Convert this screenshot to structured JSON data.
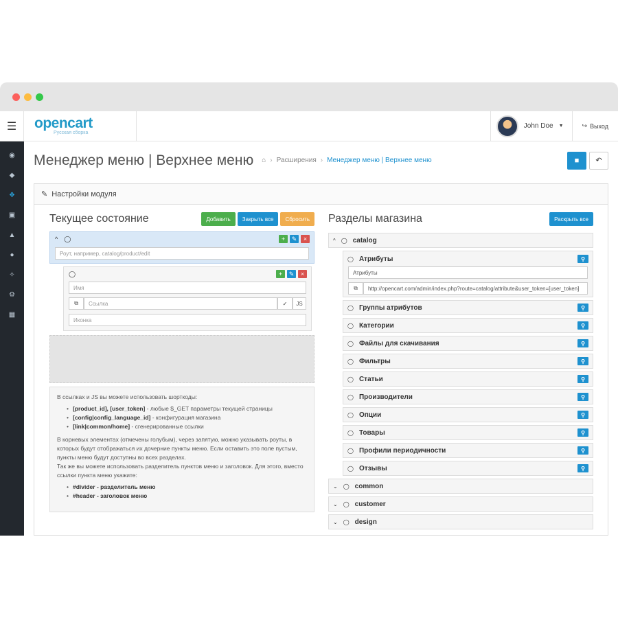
{
  "colors": {
    "accent": "#1e91cf",
    "green": "#4cae4c",
    "orange": "#f0ad4e",
    "red": "#d9534f",
    "sidebar": "#23282e"
  },
  "header": {
    "logo": "opencart",
    "logo_sub": "Русская сборка",
    "user_name": "John Doe",
    "logout": "Выход"
  },
  "sidebar": {
    "icons": [
      "dashboard-icon",
      "tags-icon",
      "puzzle-icon",
      "desktop-icon",
      "cart-icon",
      "user-icon",
      "share-icon",
      "cog-icon",
      "bar-chart-icon"
    ]
  },
  "page": {
    "title": "Менеджер меню | Верхнее меню",
    "breadcrumb_1": "Расширения",
    "breadcrumb_2": "Менеджер меню | Верхнее меню"
  },
  "panel": {
    "title": "Настройки модуля"
  },
  "left": {
    "title": "Текущее состояние",
    "btn_add": "Добавить",
    "btn_close_all": "Закрыть все",
    "btn_reset": "Сбросить",
    "route_placeholder": "Роут, например, catalog/product/edit",
    "name_placeholder": "Имя",
    "link_placeholder": "Ссылка",
    "js_label": "JS",
    "icon_placeholder": "Иконка",
    "help": {
      "intro": "В ссылках и JS вы можете использовать шорткоды:",
      "sc1_code": "[product_id], [user_token]",
      "sc1_text": " - любые $_GET параметры текущей страницы",
      "sc2_code": "[config|config_language_id]",
      "sc2_text": " - конфигурация магазина",
      "sc3_code": "[link|common/home]",
      "sc3_text": " - сгенерированные ссылки",
      "para2": "В корневых элементах (отмечены голубым), через запятую, можно указывать роуты, в которых будут отображаться их дочерние пункты меню. Если оставить это поле пустым, пункты меню будут доступны во всех разделах.",
      "para3": "Так же вы можете использовать разделитель пунктов меню и заголовок. Для этого, вместо ссылки пункта меню укажите:",
      "divider": "#divider - разделитель меню",
      "header": "#header - заголовок меню"
    }
  },
  "right": {
    "title": "Разделы магазина",
    "btn_expand": "Раскрыть все",
    "catalog": "catalog",
    "attr_title": "Атрибуты",
    "attr_name": "Атрибуты",
    "attr_url": "http://opencart.com/admin/index.php?route=catalog/attribute&user_token=[user_token]",
    "catalog_items": [
      "Группы атрибутов",
      "Категории",
      "Файлы для скачивания",
      "Фильтры",
      "Статьи",
      "Производители",
      "Опции",
      "Товары",
      "Профили периодичности",
      "Отзывы"
    ],
    "collapsed": [
      "common",
      "customer",
      "design"
    ]
  }
}
